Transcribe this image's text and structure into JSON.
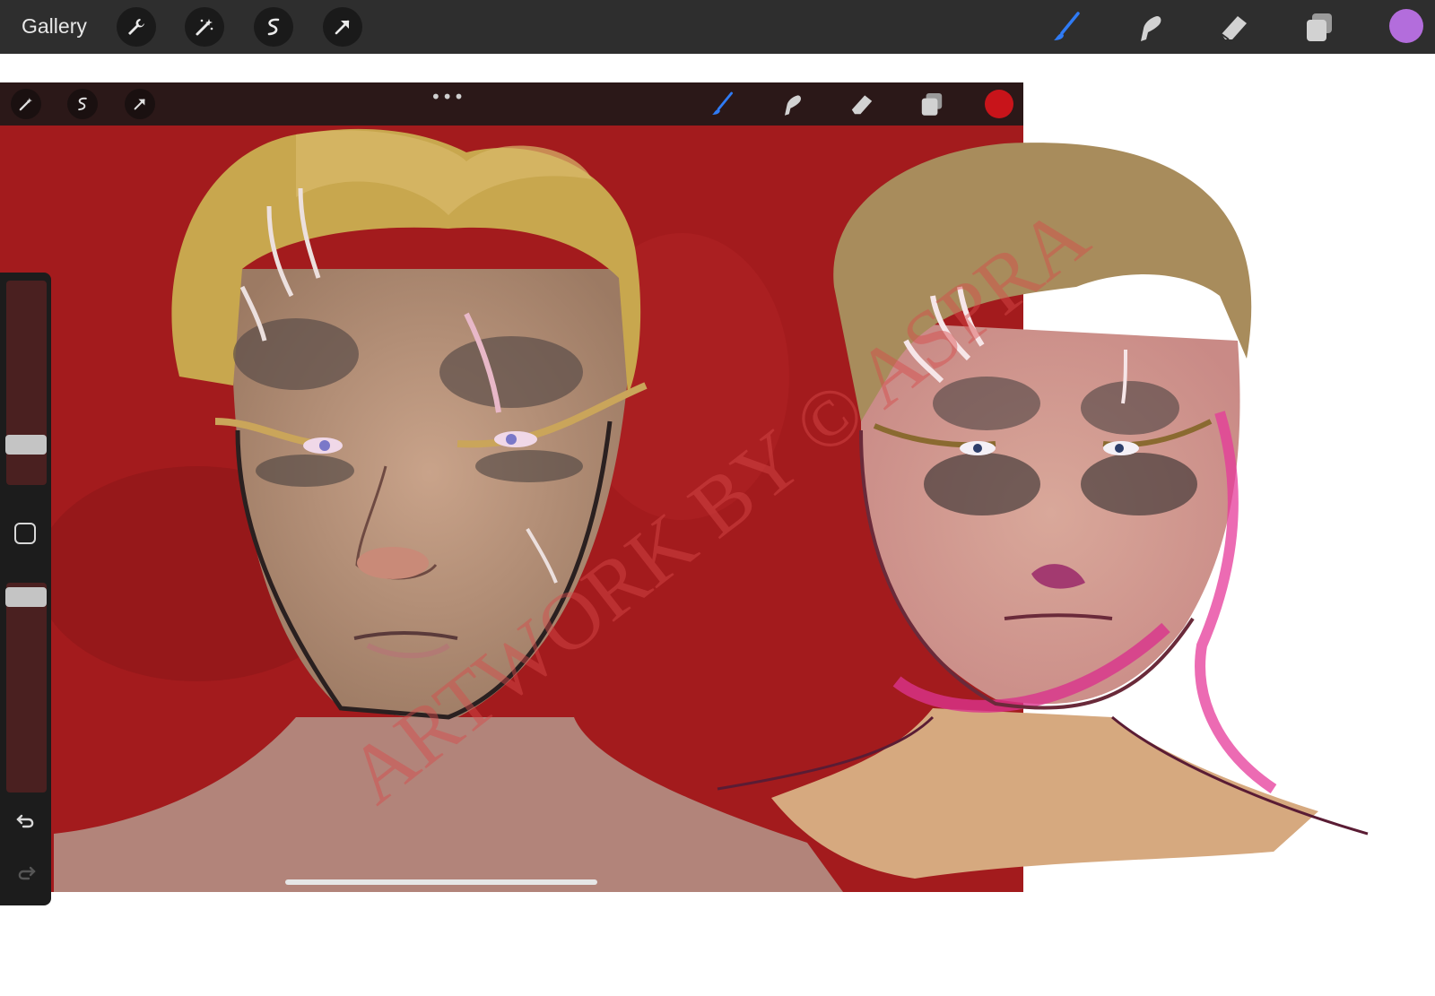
{
  "topbar": {
    "gallery_label": "Gallery",
    "left_tools": [
      "wrench-icon",
      "magic-wand-icon",
      "selection-icon",
      "transform-arrow-icon"
    ],
    "right_tools": [
      "brush-icon",
      "smudge-icon",
      "eraser-icon",
      "layers-icon"
    ],
    "active_color": "#b36ddc",
    "active_tool_color": "#2f7bf5"
  },
  "inner_toolbar": {
    "more_label": "•••",
    "left_tools": [
      "magic-wand-icon",
      "selection-icon",
      "transform-arrow-icon"
    ],
    "right_tools": [
      "brush-icon",
      "smudge-icon",
      "eraser-icon",
      "layers-icon"
    ],
    "active_color": "#c8141a"
  },
  "sidebar": {
    "tools": [
      "brush-size-slider",
      "modify-button",
      "opacity-slider",
      "undo-icon",
      "redo-icon"
    ]
  },
  "artwork": {
    "background_color": "#a31b1d",
    "watermark": "ARTWORK BY © ASPRA"
  }
}
